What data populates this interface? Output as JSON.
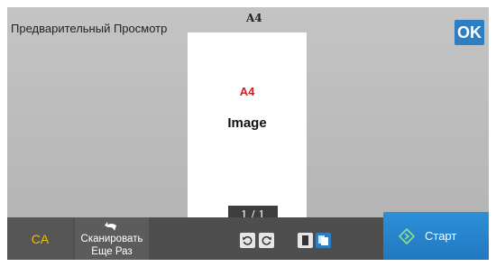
{
  "header": {
    "title": "Предварительный Просмотр",
    "ok_label": "OK",
    "paper_size": "A4"
  },
  "preview": {
    "page_size": "A4",
    "page_type": "Image",
    "page_counter": "1 / 1"
  },
  "bottom_bar": {
    "ca_label": "CA",
    "rescan_line1": "Сканировать",
    "rescan_line2": "Еще Раз",
    "start_label": "Старт",
    "rescan_icon": "undo-icon",
    "start_icon": "diamond-start-icon",
    "tools": [
      "rotate-left-icon",
      "rotate-right-icon",
      "single-page-icon",
      "multi-page-icon"
    ]
  },
  "colors": {
    "accent": "#2d7fc1",
    "ca_text": "#f0c000",
    "page_size_red": "#e0161b"
  }
}
